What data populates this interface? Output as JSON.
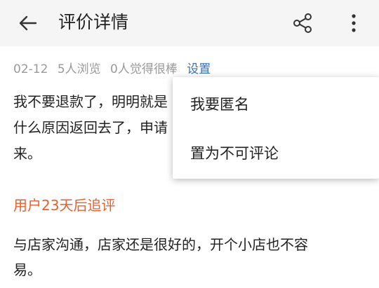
{
  "header": {
    "title": "评价详情",
    "back_icon": "arrow-left-icon",
    "share_icon": "share-icon",
    "more_icon": "more-vertical-icon"
  },
  "review": {
    "date": "02-12",
    "views": "5人浏览",
    "likes": "0人觉得很棒",
    "settings_label": "设置",
    "text": "我不要退款了，明明就是\n什么原因返回去了，申请\n来。"
  },
  "followup": {
    "heading": "用户23天后追评",
    "text": "与店家沟通，店家还是很好的，开个小店也不容\n易。"
  },
  "popup_menu": {
    "items": [
      {
        "label": "我要匿名"
      },
      {
        "label": "置为不可评论"
      }
    ]
  },
  "colors": {
    "accent_orange": "#e8602c",
    "link_blue": "#3d6fb0",
    "appbar_bg": "#f5f5f5"
  }
}
